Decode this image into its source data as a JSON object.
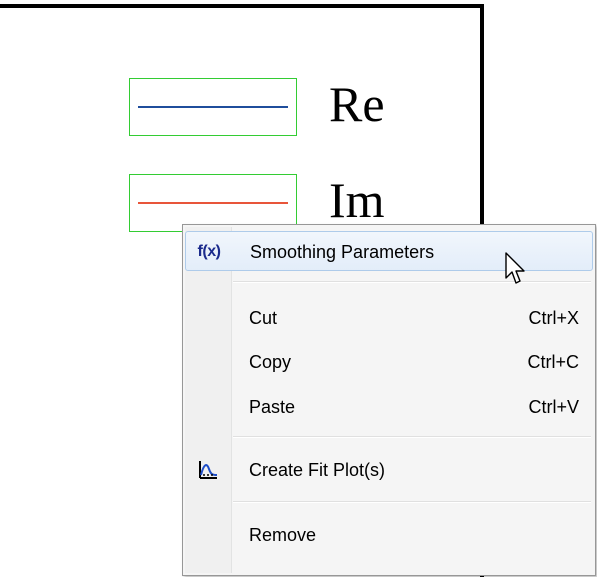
{
  "legend": {
    "entries": [
      {
        "label": "Re",
        "line_color": "#1f4e9c"
      },
      {
        "label": "Im",
        "line_color": "#e8553a"
      }
    ],
    "border_color": "#33cc33"
  },
  "context_menu": {
    "items": [
      {
        "label": "Smoothing Parameters",
        "icon": "fx-icon",
        "shortcut": ""
      },
      {
        "label": "Cut",
        "icon": "",
        "shortcut": "Ctrl+X"
      },
      {
        "label": "Copy",
        "icon": "",
        "shortcut": "Ctrl+C"
      },
      {
        "label": "Paste",
        "icon": "",
        "shortcut": "Ctrl+V"
      },
      {
        "label": "Create Fit Plot(s)",
        "icon": "fit-plot-icon",
        "shortcut": ""
      },
      {
        "label": "Remove",
        "icon": "",
        "shortcut": ""
      }
    ],
    "fx_glyph": "f(x)",
    "highlighted_item": "Smoothing Parameters"
  }
}
